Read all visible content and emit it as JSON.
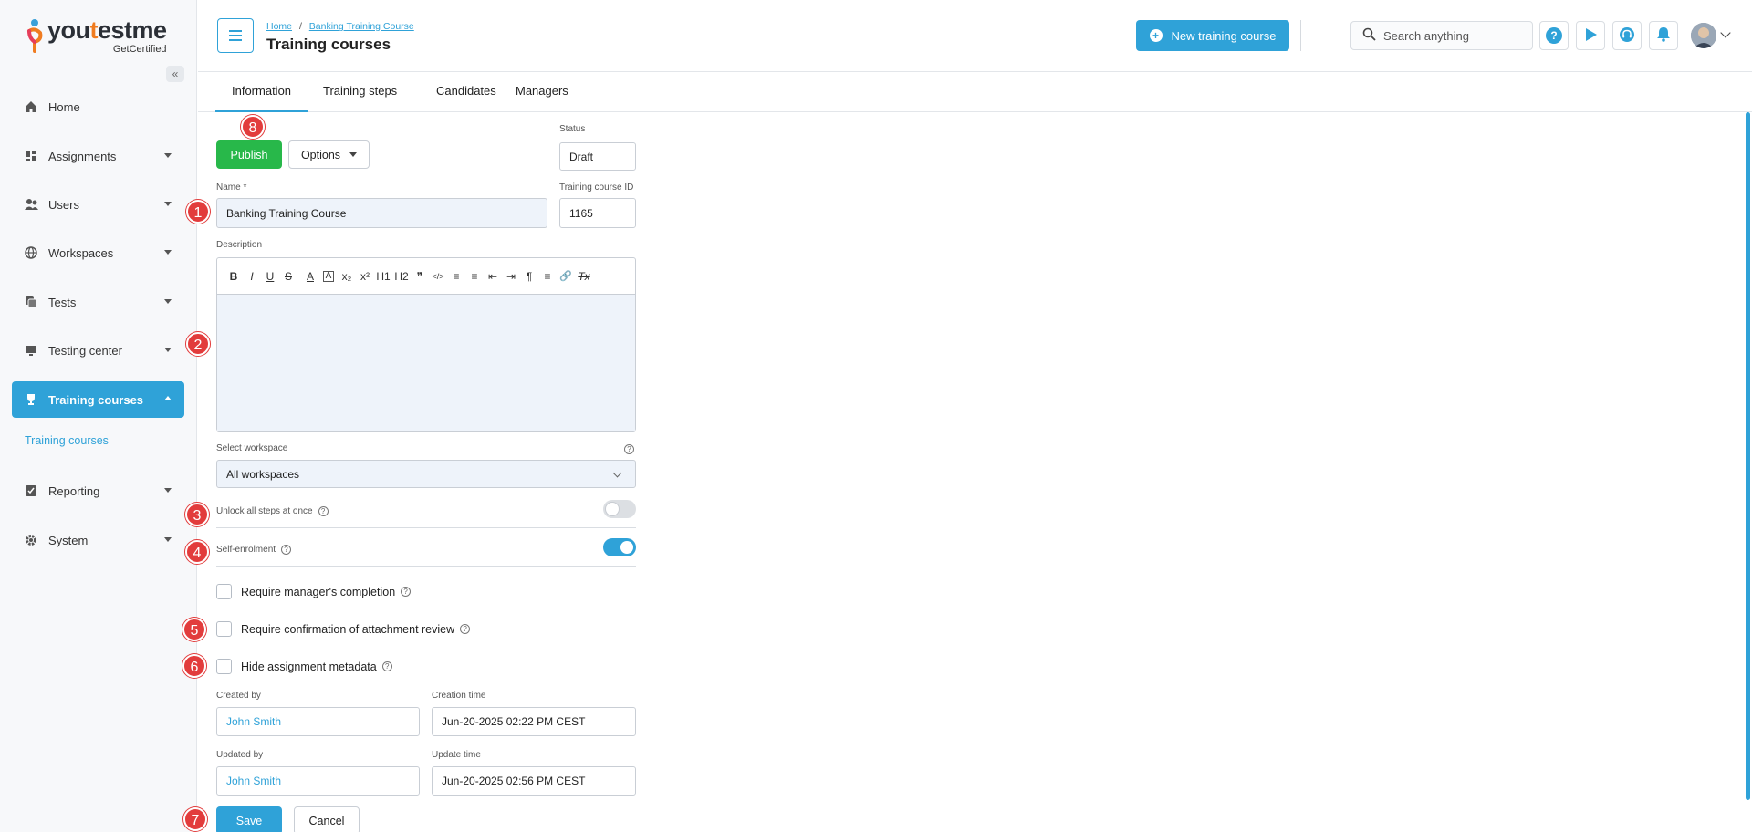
{
  "sidebar": {
    "logo": {
      "word_a": "you",
      "word_b": "t",
      "word_c": "estme",
      "sub": "GetCertified"
    },
    "collapse_icon": "«",
    "items": [
      {
        "label": "Home",
        "icon": "home-icon"
      },
      {
        "label": "Assignments",
        "icon": "dashboard-icon"
      },
      {
        "label": "Users",
        "icon": "users-icon"
      },
      {
        "label": "Workspaces",
        "icon": "globe-icon"
      },
      {
        "label": "Tests",
        "icon": "tests-icon"
      },
      {
        "label": "Testing center",
        "icon": "monitor-icon"
      },
      {
        "label": "Training courses",
        "icon": "trophy-icon"
      },
      {
        "label": "Reporting",
        "icon": "report-icon"
      },
      {
        "label": "System",
        "icon": "gear-icon"
      }
    ],
    "sub_item": "Training courses"
  },
  "header": {
    "breadcrumb": {
      "home": "Home",
      "sep": "/",
      "current": "Banking Training Course"
    },
    "title": "Training courses",
    "new_button": "New training course",
    "search_placeholder": "Search anything",
    "help_icon": "?"
  },
  "tabs": [
    "Information",
    "Training steps",
    "Candidates",
    "Managers"
  ],
  "form": {
    "publish": "Publish",
    "options": "Options",
    "status_label": "Status",
    "status_value": "Draft",
    "name_label": "Name *",
    "name_value": "Banking Training Course",
    "id_label": "Training course ID",
    "id_value": "1165",
    "description_label": "Description",
    "toolbar": [
      "B",
      "I",
      "U",
      "S",
      "A",
      "A",
      "x₂",
      "x²",
      "H1",
      "H2",
      "❞",
      "</>",
      "≡",
      "≡",
      "⇤",
      "⇥",
      "¶",
      "≡",
      "🔗",
      "Tx"
    ],
    "workspace_label": "Select workspace",
    "workspace_value": "All workspaces",
    "unlock_label": "Unlock all steps at once",
    "unlock_on": false,
    "self_enrol_label": "Self-enrolment",
    "self_enrol_on": true,
    "require_manager": "Require manager's completion",
    "require_confirm": "Require confirmation of attachment review",
    "hide_metadata": "Hide assignment metadata",
    "created_by_label": "Created by",
    "created_by": "John Smith",
    "creation_time_label": "Creation time",
    "creation_time": "Jun-20-2025 02:22 PM CEST",
    "updated_by_label": "Updated by",
    "updated_by": "John Smith",
    "update_time_label": "Update time",
    "update_time": "Jun-20-2025 02:56 PM CEST",
    "save": "Save",
    "cancel": "Cancel"
  },
  "badges": [
    "1",
    "2",
    "3",
    "4",
    "5",
    "6",
    "7",
    "8"
  ],
  "colors": {
    "accent": "#2fa2d8",
    "publish": "#28b84a",
    "badge": "#e23c3c"
  }
}
